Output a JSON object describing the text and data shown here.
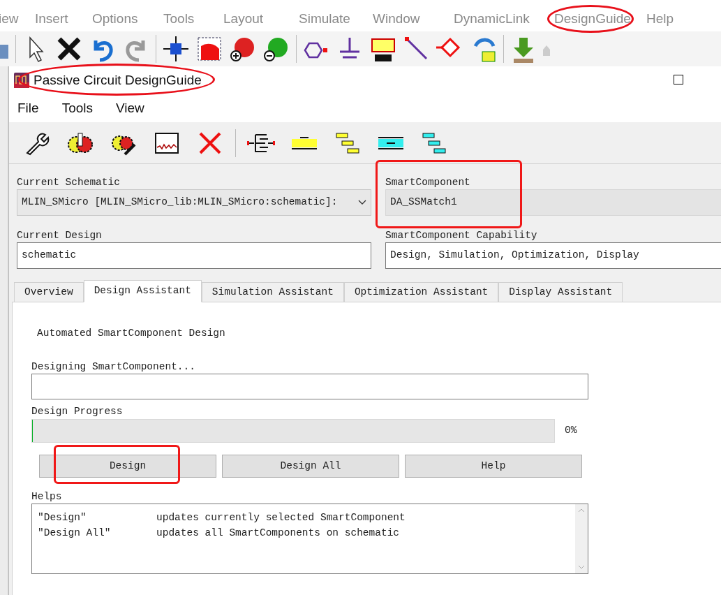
{
  "app_menu": [
    {
      "label": "iew",
      "highlighted": false
    },
    {
      "label": "Insert",
      "highlighted": false
    },
    {
      "label": "Options",
      "highlighted": false
    },
    {
      "label": "Tools",
      "highlighted": false
    },
    {
      "label": "Layout",
      "highlighted": false
    },
    {
      "label": "Simulate",
      "highlighted": false
    },
    {
      "label": "Window",
      "highlighted": false
    },
    {
      "label": "DynamicLink",
      "highlighted": false
    },
    {
      "label": "DesignGuide",
      "highlighted": true
    },
    {
      "label": "Help",
      "highlighted": false
    }
  ],
  "dialog": {
    "title": "Passive Circuit DesignGuide",
    "title_highlighted": true,
    "menu": [
      "File",
      "Tools",
      "View"
    ],
    "fields": [
      {
        "label": "Current Schematic",
        "value": "MLIN_SMicro [MLIN_SMicro_lib:MLIN_SMicro:schematic]:",
        "kind": "dropdown",
        "highlighted": false
      },
      {
        "label": "SmartComponent",
        "value": "DA_SSMatch1",
        "kind": "readonly",
        "highlighted": true
      },
      {
        "label": "Current Design",
        "value": "schematic",
        "kind": "text",
        "highlighted": false
      },
      {
        "label": "SmartComponent Capability",
        "value": "Design, Simulation, Optimization, Display",
        "kind": "text",
        "highlighted": false
      }
    ],
    "tabs": [
      {
        "label": "Overview",
        "selected": false
      },
      {
        "label": "Design Assistant",
        "selected": true
      },
      {
        "label": "Simulation Assistant",
        "selected": false
      },
      {
        "label": "Optimization Assistant",
        "selected": false
      },
      {
        "label": "Display Assistant",
        "selected": false
      }
    ],
    "panel": {
      "heading": "Automated SmartComponent Design",
      "status_label": "Designing SmartComponent...",
      "progress_label": "Design Progress",
      "progress": {
        "level": 0,
        "reading": "0%"
      },
      "buttons": [
        {
          "label": "Design",
          "highlighted": true
        },
        {
          "label": "Design All",
          "highlighted": false
        },
        {
          "label": "Help",
          "highlighted": false
        }
      ],
      "helps_label": "Helps",
      "helps": [
        {
          "term": "\"Design\"",
          "text": "updates currently selected SmartComponent"
        },
        {
          "term": "\"Design All\"",
          "text": "updates all SmartComponents on schematic"
        }
      ]
    }
  }
}
